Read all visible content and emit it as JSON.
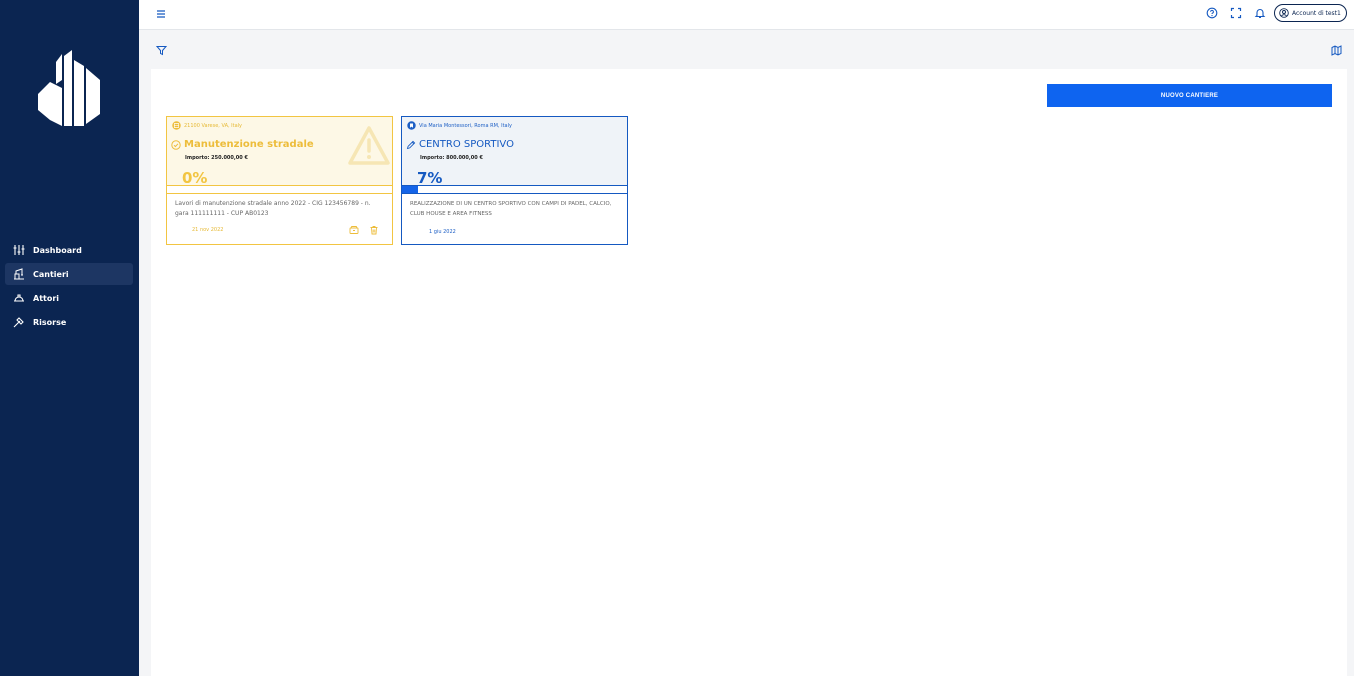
{
  "sidebar": {
    "logo": "building-logo",
    "items": [
      {
        "label": "Dashboard",
        "icon": "sliders-icon",
        "active": false
      },
      {
        "label": "Cantieri",
        "icon": "crane-icon",
        "active": true
      },
      {
        "label": "Attori",
        "icon": "hardhat-icon",
        "active": false
      },
      {
        "label": "Risorse",
        "icon": "hammer-icon",
        "active": false
      }
    ]
  },
  "topbar": {
    "account_label": "Account di test1",
    "icons": [
      "menu-icon",
      "help-icon",
      "fullscreen-icon",
      "bell-icon",
      "user-circle-icon"
    ]
  },
  "toolbar": {
    "filter_icon": "filter-icon",
    "map_icon": "map-icon",
    "new_button_label": "NUOVO CANTIERE"
  },
  "colors": {
    "sidebar_bg": "#0b2551",
    "primary": "#0e64f0",
    "yellow": "#f2c542",
    "blue": "#1559c1"
  },
  "cards": [
    {
      "address": "21100 Varese, VA, Italy",
      "title": "Manutenzione stradale",
      "importo": "Importo: 250.000,00 €",
      "percent_label": "0%",
      "progress": 0,
      "description": "Lavori di manutenzione stradale anno 2022 - CIG 123456789 - n. gara 111111111 - CUP AB0123",
      "date": "21 nov 2022",
      "status_icon": "check-circle-icon",
      "type_icon": "road-icon"
    },
    {
      "address": "Via Maria Montessori, Roma RM, Italy",
      "title": "CENTRO SPORTIVO",
      "importo": "Importo: 800.000,00 €",
      "percent_label": "7%",
      "progress": 0.07,
      "description": "REALIZZAZIONE DI UN CENTRO SPORTIVO CON CAMPI DI PADEL, CALCIO, CLUB HOUSE E AREA FITNESS",
      "date": "1 giu 2022",
      "status_icon": "pencil-icon",
      "type_icon": "building-pin-icon"
    }
  ]
}
